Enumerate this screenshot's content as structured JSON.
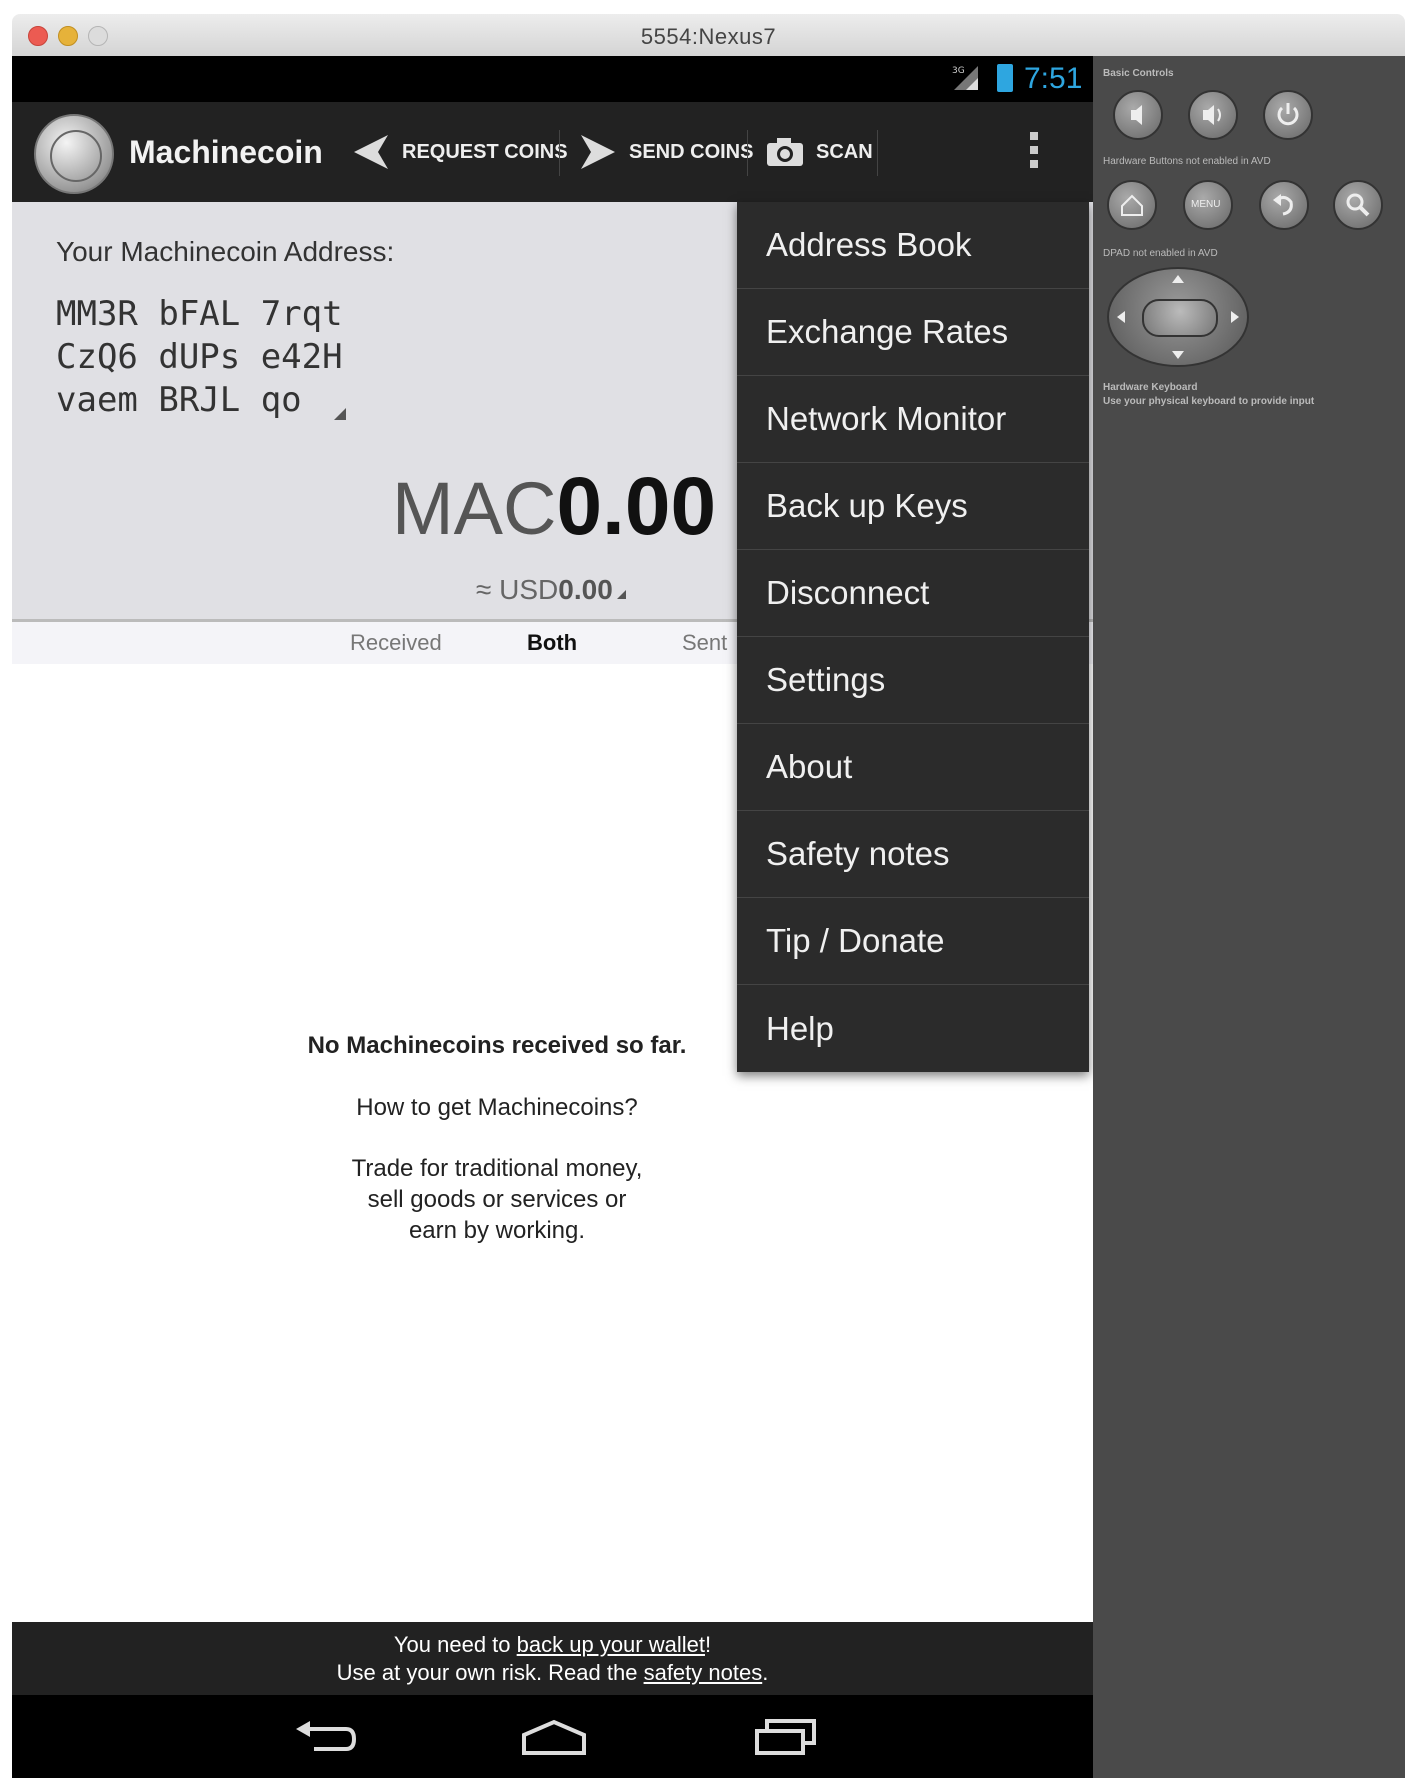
{
  "window": {
    "title": "5554:Nexus7"
  },
  "status_bar": {
    "time": "7:51"
  },
  "action_bar": {
    "title": "Machinecoin",
    "request_label": "REQUEST COINS",
    "send_label": "SEND COINS",
    "scan_label": "SCAN"
  },
  "header": {
    "address_label": "Your Machinecoin Address:",
    "address_lines": [
      "MM3R bFAL 7rqt",
      "CzQ6 dUPs e42H",
      "vaem BRJL qo"
    ],
    "balance_currency": "MAC",
    "balance_value": "0.00",
    "fiat_prefix": "≈ USD",
    "fiat_value": "0.00"
  },
  "tabs": [
    "Received",
    "Both",
    "Sent"
  ],
  "empty_state": {
    "line1": "No Machinecoins received so far.",
    "line2": "How to get Machinecoins?",
    "line3": "Trade for traditional money,",
    "line4": "sell goods or services or",
    "line5": "earn by working."
  },
  "footer": {
    "line1_a": "You need to ",
    "line1_link": "back up your wallet",
    "line1_b": "!",
    "line2_a": "Use at your own risk. Read the ",
    "line2_link": "safety notes",
    "line2_b": "."
  },
  "menu": {
    "items": [
      "Address Book",
      "Exchange Rates",
      "Network Monitor",
      "Back up Keys",
      "Disconnect",
      "Settings",
      "About",
      "Safety notes",
      "Tip / Donate",
      "Help"
    ]
  },
  "emulator_panel": {
    "basic_controls": "Basic Controls",
    "hardware_buttons": "Hardware Buttons not enabled in AVD",
    "dpad": "DPAD not enabled in AVD",
    "keyboard_title": "Hardware Keyboard",
    "keyboard_sub": "Use your physical keyboard to provide input",
    "menu_label": "MENU"
  },
  "colors": {
    "accent": "#2ea6e0",
    "actionbar": "#222222",
    "header_bg": "#e0e0e4",
    "menu_bg": "#2b2b2b"
  }
}
